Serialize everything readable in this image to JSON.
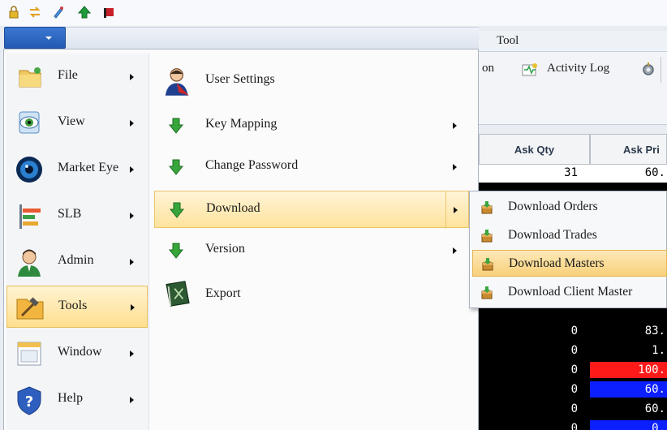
{
  "quick_toolbar": {
    "icons": [
      "lock-icon",
      "exchange-arrows-icon",
      "pen-icon",
      "green-up-arrow-icon",
      "red-flag-icon"
    ]
  },
  "ribbon": {
    "tab_label": "Tool",
    "partial_label": "on",
    "activity_log_label": "Activity Log"
  },
  "grid": {
    "headers": [
      "Ask Qty",
      "Ask Pri"
    ],
    "rows": [
      {
        "qty": "31",
        "price": "60.",
        "price_bg": "#ffffff",
        "qty_bg": "#ffffff"
      },
      {
        "qty": "0",
        "price": "83.",
        "price_bg": "#000000"
      },
      {
        "qty": "0",
        "price": "1.",
        "price_bg": "#000000"
      },
      {
        "qty": "0",
        "price": "100.",
        "price_bg": "#ff1a1a"
      },
      {
        "qty": "0",
        "price": "60.",
        "price_bg": "#0b1fff"
      },
      {
        "qty": "0",
        "price": "60.",
        "price_bg": "#000000"
      },
      {
        "qty": "0",
        "price": "0.",
        "price_bg": "#0b1fff"
      }
    ]
  },
  "app_menu": {
    "left_items": [
      {
        "label": "File",
        "icon": "folder-icon"
      },
      {
        "label": "View",
        "icon": "eye-icon"
      },
      {
        "label": "Market Eye",
        "icon": "market-eye-icon"
      },
      {
        "label": "SLB",
        "icon": "bars-icon"
      },
      {
        "label": "Admin",
        "icon": "admin-user-icon"
      },
      {
        "label": "Tools",
        "icon": "tools-hammer-icon"
      },
      {
        "label": "Window",
        "icon": "window-icon"
      },
      {
        "label": "Help",
        "icon": "help-shield-icon"
      }
    ],
    "active_left": "Tools",
    "right_items": [
      {
        "label": "User Settings",
        "icon": "user-settings-icon"
      },
      {
        "label": "Key Mapping",
        "icon": "green-down-arrow-icon"
      },
      {
        "label": "Change Password",
        "icon": "green-down-arrow-icon"
      },
      {
        "label": "Download",
        "icon": "green-down-arrow-icon"
      },
      {
        "label": "Version",
        "icon": "green-down-arrow-icon"
      },
      {
        "label": "Export",
        "icon": "export-book-icon"
      }
    ],
    "active_right": "Download"
  },
  "download_submenu": {
    "items": [
      {
        "label": "Download Orders",
        "icon": "download-box-icon"
      },
      {
        "label": "Download Trades",
        "icon": "download-box-icon"
      },
      {
        "label": "Download Masters",
        "icon": "download-box-icon"
      },
      {
        "label": "Download Client Master",
        "icon": "download-box-icon"
      }
    ],
    "highlighted": "Download Masters"
  },
  "colors": {
    "menu_button": "#2b64c0",
    "hover_gold": "#ffdf8f",
    "grid_black": "#000000",
    "red_cell": "#ff1a1a",
    "blue_cell": "#0b1fff"
  }
}
